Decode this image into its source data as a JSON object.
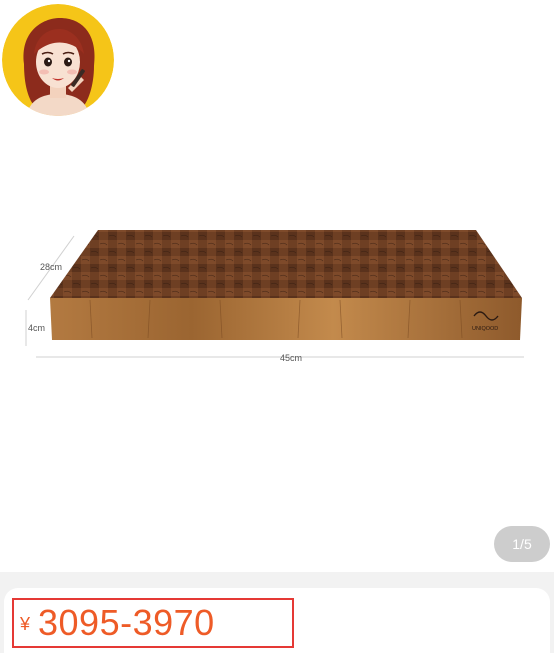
{
  "gallery": {
    "image_subject": "end-grain wooden cutting board",
    "dimension_labels": {
      "depth": "28cm",
      "height": "4cm",
      "width": "45cm"
    },
    "board_logo": "UNIQOOD",
    "pager": {
      "current": 1,
      "total": 5,
      "text": "1/5"
    }
  },
  "product": {
    "currency_symbol": "¥",
    "price_range": "3095-3970",
    "price_color": "#ee5b27",
    "highlight_color": "#e53935"
  },
  "avatar": {
    "description": "cartoon avatar of a woman with red hair on a yellow circle",
    "background_color": "#f5c518"
  }
}
